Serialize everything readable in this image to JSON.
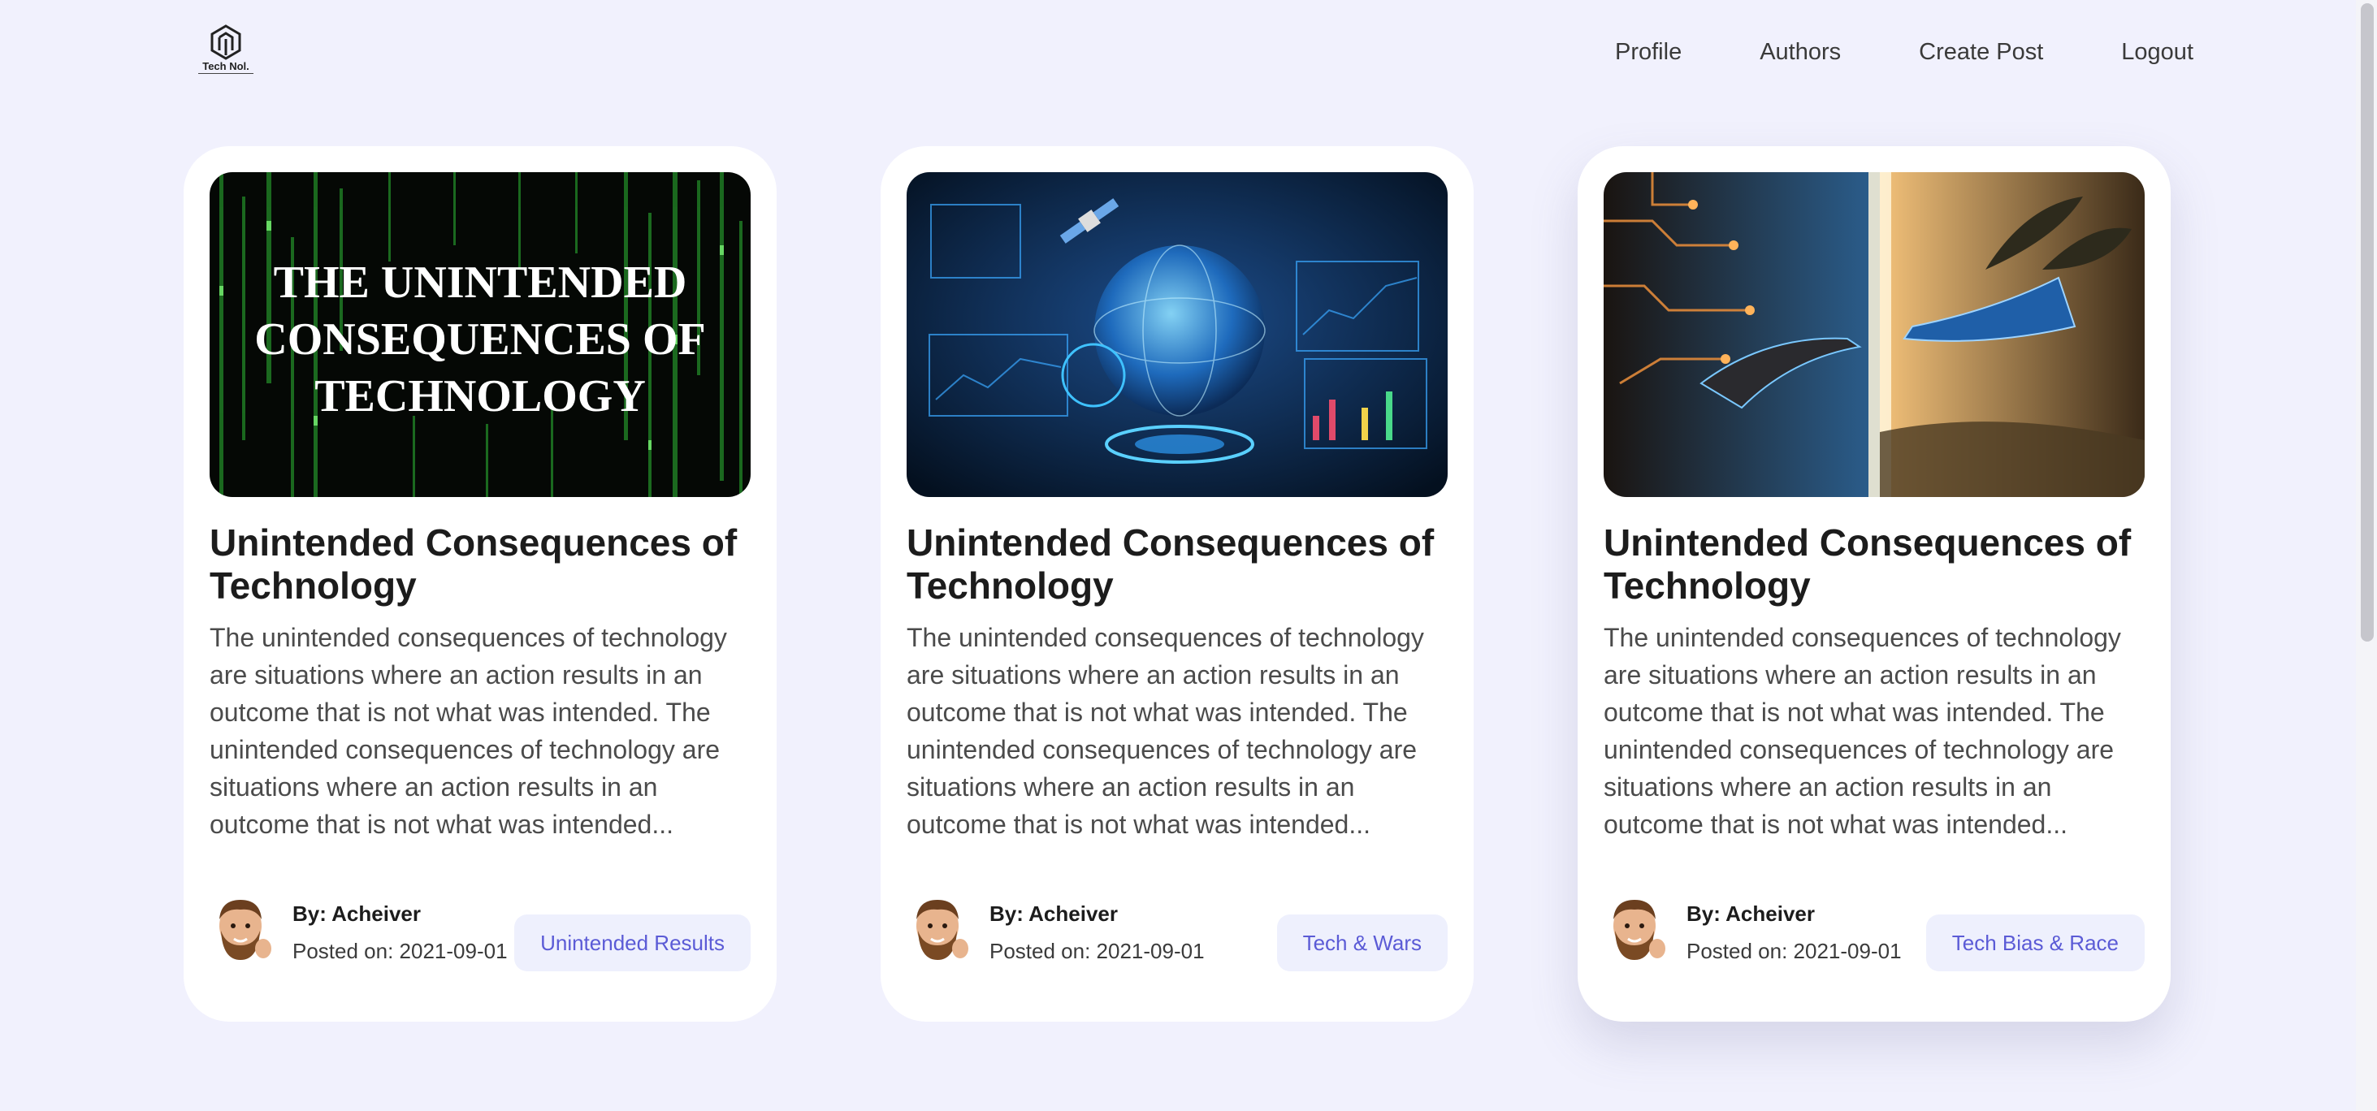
{
  "brand": {
    "logo_text": "Tech Nol."
  },
  "nav": {
    "items": [
      {
        "label": "Profile"
      },
      {
        "label": "Authors"
      },
      {
        "label": "Create Post"
      },
      {
        "label": "Logout"
      }
    ]
  },
  "posts": [
    {
      "image_text": [
        "THE UNINTENDED",
        "CONSEQUENCES OF",
        "TECHNOLOGY"
      ],
      "title": "Unintended Consequences of Technology",
      "excerpt": "The unintended consequences of technology are situations where an action results in an outcome that is not what was intended. The unintended consequences of technology are situations where an action results in an outcome that is not what was intended...",
      "author": "By: Acheiver",
      "posted": "Posted on: 2021-09-01",
      "tag": "Unintended Results"
    },
    {
      "title": "Unintended Consequences of Technology",
      "excerpt": "The unintended consequences of technology are situations where an action results in an outcome that is not what was intended. The unintended consequences of technology are situations where an action results in an outcome that is not what was intended...",
      "author": "By: Acheiver",
      "posted": "Posted on: 2021-09-01",
      "tag": "Tech & Wars"
    },
    {
      "title": "Unintended Consequences of Technology",
      "excerpt": "The unintended consequences of technology are situations where an action results in an outcome that is not what was intended. The unintended consequences of technology are situations where an action results in an outcome that is not what was intended...",
      "author": "By: Acheiver",
      "posted": "Posted on: 2021-09-01",
      "tag": "Tech Bias & Race"
    }
  ],
  "colors": {
    "background": "#f1f1fd",
    "card": "#ffffff",
    "tag_bg": "#eef0fd",
    "tag_text": "#5b5bd6"
  }
}
